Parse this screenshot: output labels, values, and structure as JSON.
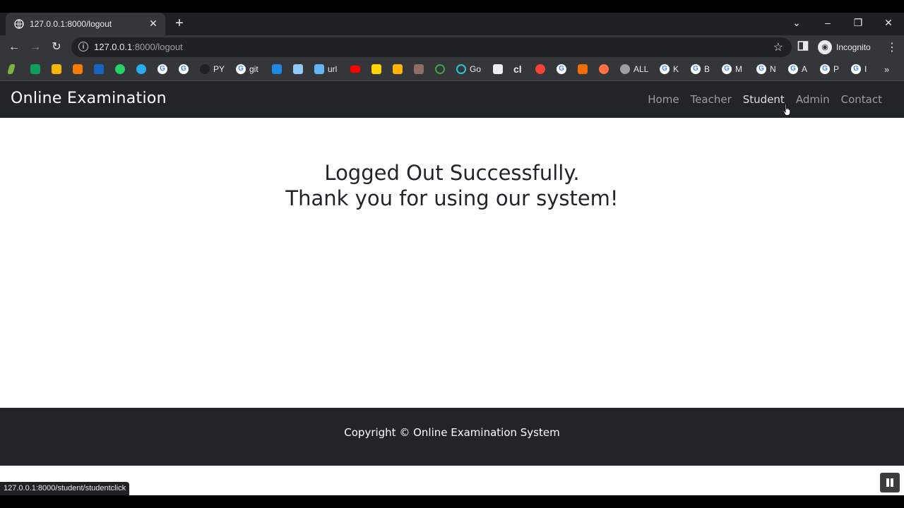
{
  "browser": {
    "tab_title": "127.0.0.1:8000/logout",
    "url_host": "127.0.0.1",
    "url_path": ":8000/logout",
    "profile_label": "Incognito",
    "status_url": "127.0.0.1:8000/student/studentclick"
  },
  "bookmarks": [
    {
      "label": "PY"
    },
    {
      "label": "git"
    },
    {
      "label": "url"
    },
    {
      "label": "Go"
    },
    {
      "label": "cl"
    },
    {
      "label": "ALL"
    },
    {
      "label": "K"
    },
    {
      "label": "B"
    },
    {
      "label": "M"
    },
    {
      "label": "N"
    },
    {
      "label": "A"
    },
    {
      "label": "P"
    },
    {
      "label": "I"
    }
  ],
  "site": {
    "brand": "Online Examination",
    "nav": [
      "Home",
      "Teacher",
      "Student",
      "Admin",
      "Contact"
    ],
    "message_line1": "Logged Out Successfully.",
    "message_line2": "Thank you for using our system!",
    "footer": "Copyright © Online Examination System"
  },
  "colors": {
    "navbar_bg": "#212529",
    "chrome_dark": "#202124",
    "chrome_toolbar": "#35363a"
  }
}
